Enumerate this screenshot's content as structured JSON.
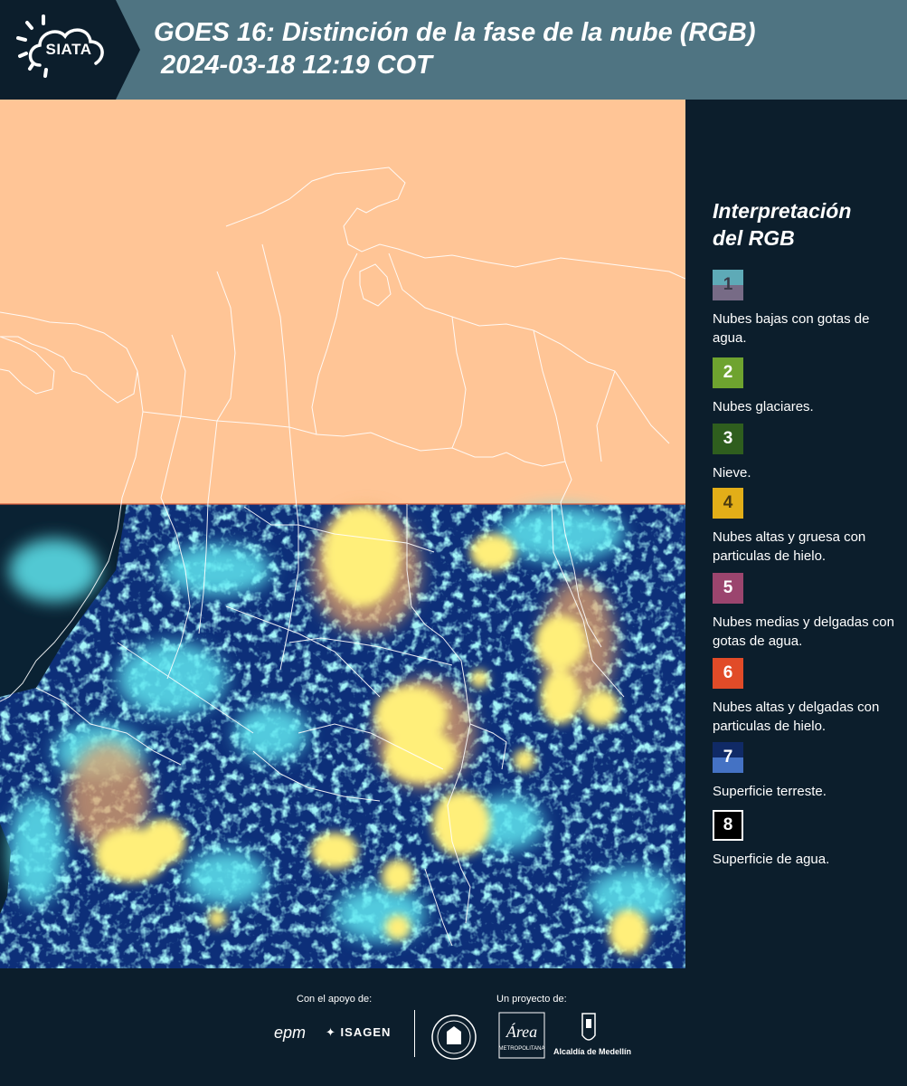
{
  "header": {
    "logo_text": "SIATA",
    "title": "GOES 16: Distinción de la fase de la nube (RGB)",
    "subtitle": "2024-03-18 12:19 COT"
  },
  "legend": {
    "title_line1": "Interpretación",
    "title_line2": "del RGB",
    "items": [
      {
        "num": "1",
        "desc": "Nubes bajas con gotas de agua.",
        "colors": [
          "#5eaab7",
          "#776b86"
        ]
      },
      {
        "num": "2",
        "desc": "Nubes glaciares.",
        "colors": [
          "#6ea32f"
        ]
      },
      {
        "num": "3",
        "desc": "Nieve.",
        "colors": [
          "#2f5e1e"
        ]
      },
      {
        "num": "4",
        "desc": "Nubes altas y gruesa con particulas de hielo.",
        "colors": [
          "#e2ae18"
        ]
      },
      {
        "num": "5",
        "desc": "Nubes medias y delgadas con gotas de agua.",
        "colors": [
          "#9b456e"
        ]
      },
      {
        "num": "6",
        "desc": "Nubes altas y delgadas con particulas de hielo.",
        "colors": [
          "#e14b28"
        ]
      },
      {
        "num": "7",
        "desc": "Superficie terreste.",
        "colors": [
          "#102a66",
          "#4472c4"
        ]
      },
      {
        "num": "8",
        "desc": "Superficie de agua.",
        "colors": [
          "#000000"
        ]
      }
    ]
  },
  "map": {
    "no_data_color": "#ffc596",
    "ocean_color": "#0a2233",
    "land_color": "#0d2f79",
    "cloud_colors": [
      "#5fe6f0",
      "#ffef7a",
      "#e6a36b"
    ],
    "border_color": "#ffffff"
  },
  "footer": {
    "support_label": "Con el apoyo de:",
    "project_label": "Un proyecto de:",
    "epm": "epm",
    "isagen": "ISAGEN",
    "area_logo": "Área",
    "area_sub": "METROPOLITANA",
    "alcaldia": "Alcaldía de Medellín"
  },
  "colors": {
    "header_bg": "#4f7482",
    "logo_panel_bg": "#0c1e2c",
    "page_bg": "#0c1e2c"
  }
}
